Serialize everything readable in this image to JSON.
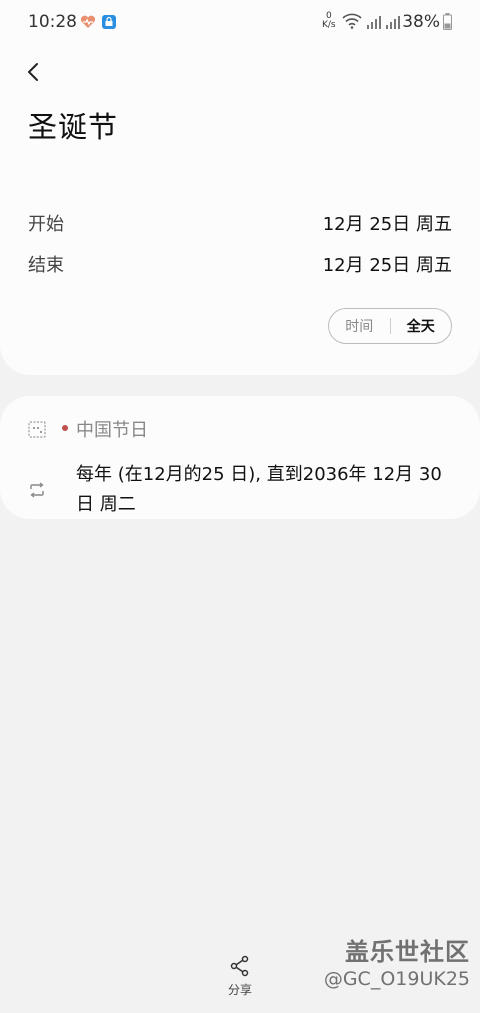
{
  "status_bar": {
    "time": "10:28",
    "net_speed_top": "0",
    "net_speed_unit": "K/s",
    "battery": "38%",
    "icons": [
      "heart-monitor-icon",
      "lock-icon",
      "wifi-icon",
      "signal-icon",
      "battery-icon"
    ]
  },
  "event": {
    "title": "圣诞节",
    "start_label": "开始",
    "start_value": "12月 25日 周五",
    "end_label": "结束",
    "end_value": "12月 25日 周五",
    "toggle": {
      "time_label": "时间",
      "all_day_label": "全天",
      "selected": "全天"
    }
  },
  "details": {
    "calendar_name": "中国节日",
    "calendar_color": "#c0504d",
    "repeat_text": "每年 (在12月的25 日), 直到2036年 12月 30 日 周二"
  },
  "bottom_bar": {
    "share_label": "分享"
  },
  "watermark": {
    "title": "盖乐世社区",
    "user": "@GC_O19UK25"
  }
}
